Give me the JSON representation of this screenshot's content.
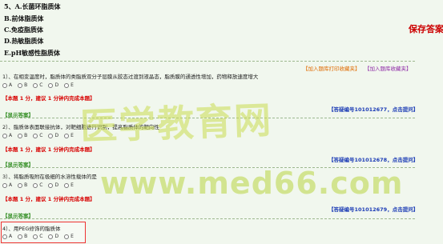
{
  "options": [
    "5、A.长菌环脂质体",
    "B.前体脂质体",
    "C.免疫脂质体",
    "D.热敏脂质体",
    "E.pH敏感性脂质体"
  ],
  "save_label": "保存答案",
  "collect_links": {
    "print": "【加入题库打印收藏夹】",
    "error": "【加入题库收藏夹】"
  },
  "questions": [
    {
      "text": "1）、在相变温度时，脂质体的类脂质双分子层膜从胶态过渡到液晶态，脂质膜的通透性增加，药物释放速度增大",
      "choices": [
        "A",
        "B",
        "C",
        "D",
        "E"
      ],
      "score": "【本题 1 分，建议 1 分钟内完成本题】",
      "answer_ref": "【答疑编号101012677，点击提问】",
      "show_answer": "【显示答案】"
    },
    {
      "text": "2）、脂质体表面联接抗体，对靶细胞进行识别，提高脂质体的靶向性",
      "choices": [
        "A",
        "B",
        "C",
        "D",
        "E"
      ],
      "score": "【本题 1 分，建议 1 分钟内完成本题】",
      "answer_ref": "【答疑编号101012678，点击提问】",
      "show_answer": "【显示答案】"
    },
    {
      "text": "3）、将脂质吸附在极细的水溶性载体的是",
      "choices": [
        "A",
        "B",
        "C",
        "D",
        "E"
      ],
      "score": "【本题 1 分，建议 1 分钟内完成本题】",
      "answer_ref": "【答疑编号101012679，点击提问】",
      "show_answer": "【显示答案】"
    },
    {
      "text": "4）、用PEG修饰的脂质体",
      "choices": [
        "A",
        "B",
        "C",
        "D",
        "E"
      ]
    }
  ],
  "watermark": {
    "cn": "医学教育网",
    "url": "www.med66.com"
  },
  "colors": {
    "background": "#f1f7ee",
    "score_red": "#d80000",
    "answer_blue": "#1b3bb5",
    "show_green": "#2e8b1e",
    "save_red": "#cc0000"
  }
}
